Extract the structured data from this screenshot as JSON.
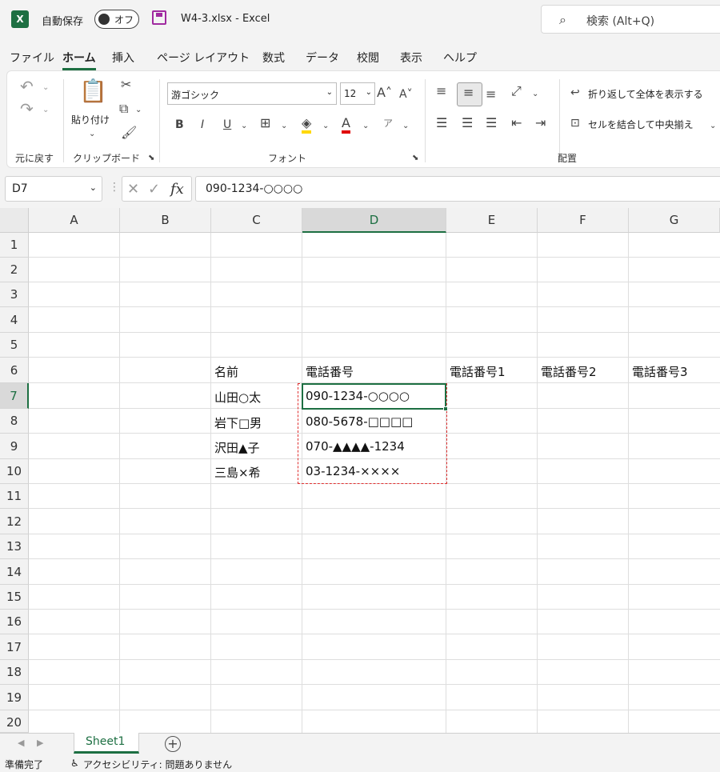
{
  "titlebar": {
    "logo": "X",
    "autosave_label": "自動保存",
    "autosave_toggle": "オフ",
    "doc_title": "W4-3.xlsx  -  Excel",
    "search_placeholder": "検索 (Alt+Q)"
  },
  "menu": {
    "tabs": [
      "ファイル",
      "ホーム",
      "挿入",
      "ページ レイアウト",
      "数式",
      "データ",
      "校閲",
      "表示",
      "ヘルプ"
    ],
    "active": "ホーム"
  },
  "ribbon": {
    "undo_group_label": "元に戻す",
    "paste_label": "貼り付け",
    "clipboard_group_label": "クリップボード",
    "font_name": "游ゴシック",
    "font_size": "12",
    "font_group_label": "フォント",
    "bold": "B",
    "italic": "I",
    "underline": "U",
    "wrap_text": "折り返して全体を表示する",
    "merge_center": "セルを結合して中央揃え",
    "alignment_group_label": "配置",
    "font_color_accent": "#e00000",
    "fill_color_accent": "#ffd800"
  },
  "formula_bar": {
    "name_box": "D7",
    "formula": "090-1234-○○○○"
  },
  "grid": {
    "columns": [
      "A",
      "B",
      "C",
      "D",
      "E",
      "F",
      "G"
    ],
    "rows": [
      "1",
      "2",
      "3",
      "4",
      "5",
      "6",
      "7",
      "8",
      "9",
      "10",
      "11",
      "12",
      "13",
      "14",
      "15",
      "16",
      "17",
      "18",
      "19",
      "20"
    ],
    "selected_column": "D",
    "selected_row": "7",
    "cells": {
      "C6": "名前",
      "D6": "電話番号",
      "E6": "電話番号1",
      "F6": "電話番号2",
      "G6": "電話番号3",
      "C7": "山田○太",
      "D7": "090-1234-○○○○",
      "C8": "岩下□男",
      "D8": "080-5678-□□□□",
      "C9": "沢田▲子",
      "D9": "070-▲▲▲▲-1234",
      "C10": "三島×希",
      "D10": "03-1234-××××"
    }
  },
  "sheets": {
    "tabs": [
      "Sheet1"
    ],
    "active": "Sheet1"
  },
  "status": {
    "ready": "準備完了",
    "accessibility": "アクセシビリティ: 問題ありません"
  },
  "colors": {
    "accent": "#1d6f42",
    "marquee": "#e03030"
  }
}
